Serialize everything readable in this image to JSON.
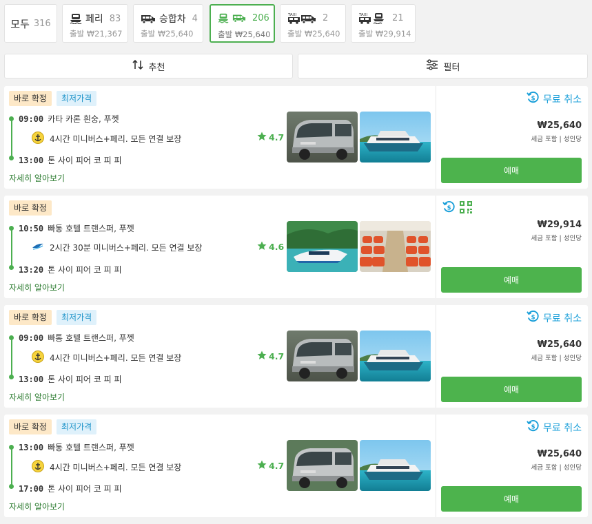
{
  "tabs": [
    {
      "label": "모두",
      "count": "316"
    },
    {
      "label": "페리",
      "count": "83",
      "price": "출발 ₩21,367"
    },
    {
      "label": "승합차",
      "count": "4",
      "price": "출발 ₩25,640"
    },
    {
      "count": "206",
      "price": "출발 ₩25,640"
    },
    {
      "count": "2",
      "price": "출발 ₩25,640"
    },
    {
      "count": "21",
      "price": "출발 ₩29,914"
    }
  ],
  "taxi_label": "TAXI",
  "sort": {
    "recommend": "추천",
    "filter": "필터"
  },
  "badge_confirm": "바로 확정",
  "badge_cheapest": "최저가격",
  "free_cancel": "무료 취소",
  "tax_note": "세금 포함 | 성인당",
  "book_label": "예매",
  "detail_link": "자세히 알아보기",
  "results": [
    {
      "dep_time": "09:00",
      "dep_place": "카타 카론 흰숭, 푸껫",
      "route": "4시간 미니버스+페리. 모든 연결 보장",
      "arr_time": "13:00",
      "arr_place": "톤 사이 피어 코 피 피",
      "rating": "4.7",
      "price": "₩25,640",
      "operator_icon": "anchor-logo-icon"
    },
    {
      "dep_time": "10:50",
      "dep_place": "빠통 호텔 트랜스퍼, 푸껫",
      "route": "2시간 30분 미니버스+페리. 모든 연결 보장",
      "arr_time": "13:20",
      "arr_place": "톤 사이 피어 코 피 피",
      "rating": "4.6",
      "price": "₩29,914",
      "operator_icon": "speedboat-logo-icon"
    },
    {
      "dep_time": "09:00",
      "dep_place": "빠통 호텔 트랜스퍼, 푸껫",
      "route": "4시간 미니버스+페리. 모든 연결 보장",
      "arr_time": "13:00",
      "arr_place": "톤 사이 피어 코 피 피",
      "rating": "4.7",
      "price": "₩25,640",
      "operator_icon": "anchor-logo-icon"
    },
    {
      "dep_time": "13:00",
      "dep_place": "빠통 호텔 트랜스퍼, 푸껫",
      "route": "4시간 미니버스+페리. 모든 연결 보장",
      "arr_time": "17:00",
      "arr_place": "톤 사이 피어 코 피 피",
      "rating": "4.7",
      "price": "₩25,640",
      "operator_icon": "anchor-logo-icon"
    }
  ],
  "colors": {
    "accent_green": "#4caf50",
    "cancel_blue": "#1a9fd9",
    "badge_orange_bg": "#fde8c7",
    "badge_blue_bg": "#dff1fb"
  }
}
